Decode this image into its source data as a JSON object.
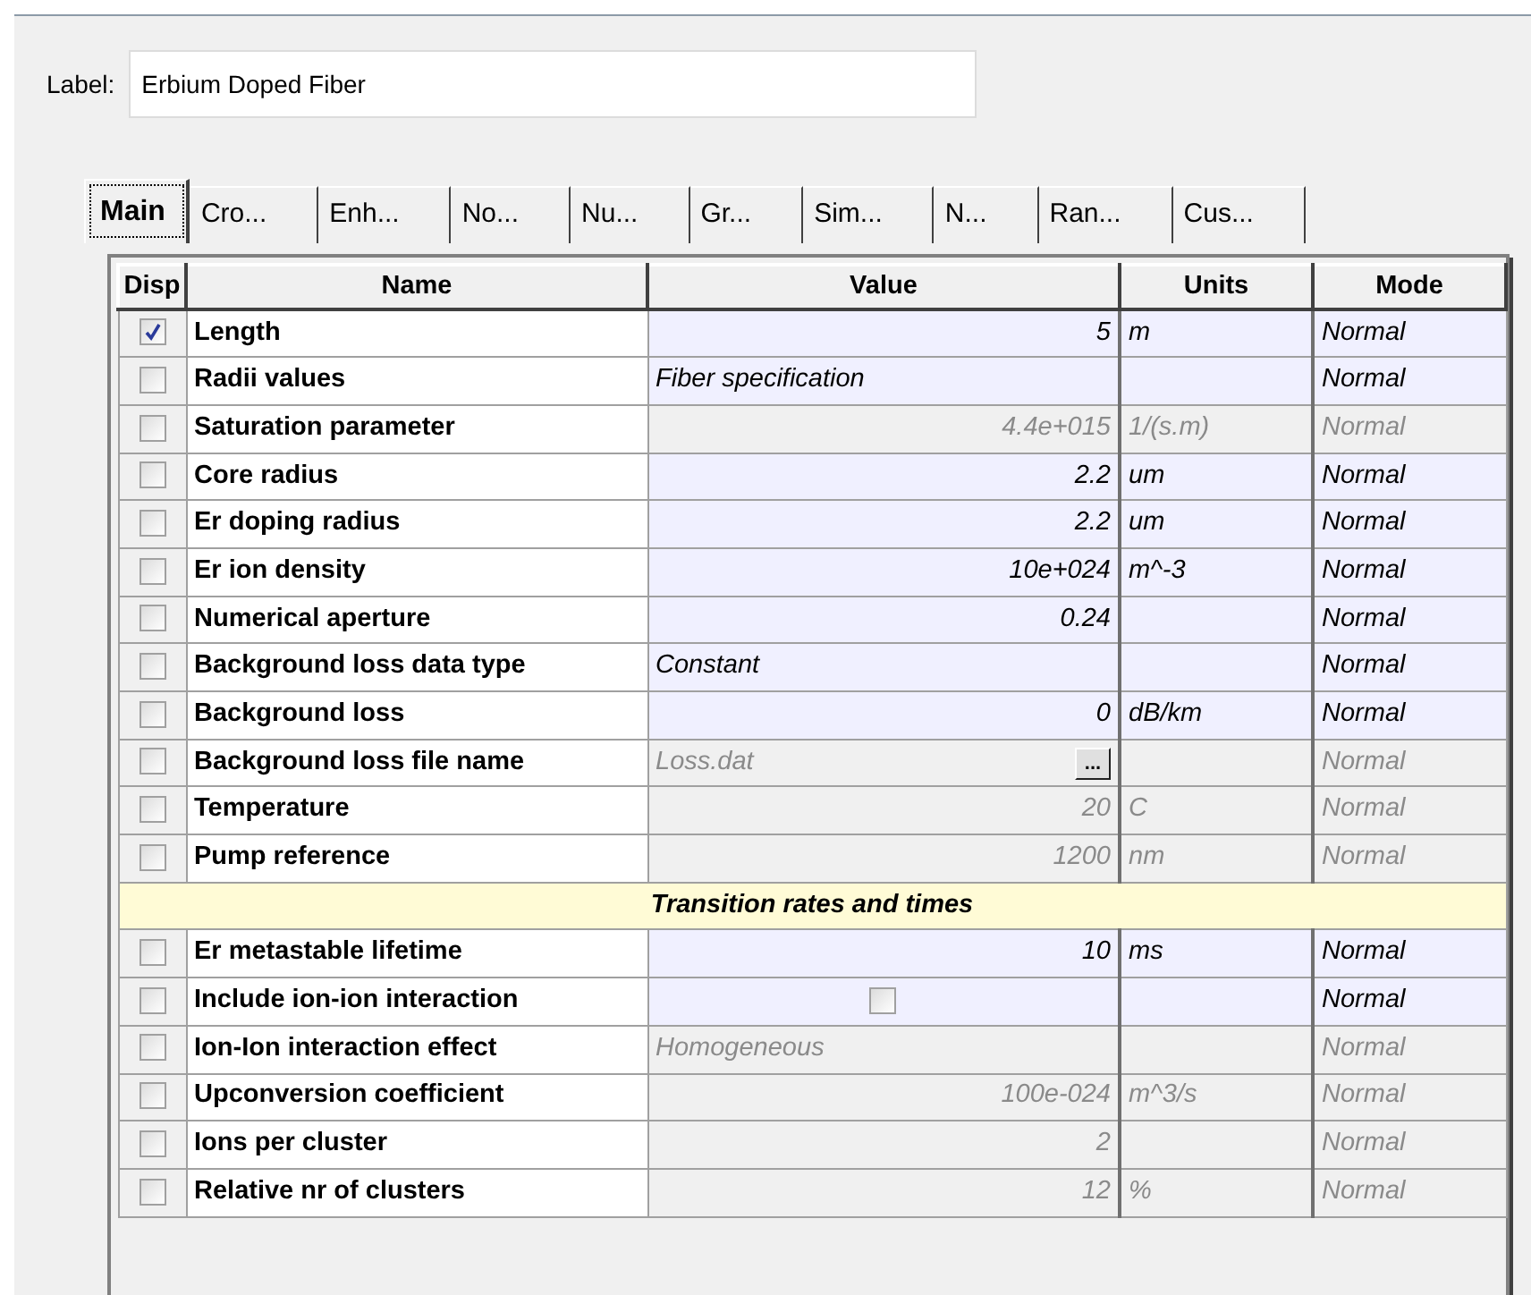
{
  "label_field": {
    "label": "Label:",
    "value": "Erbium Doped Fiber"
  },
  "tabs": [
    {
      "label": "Main",
      "selected": true
    },
    {
      "label": "Cro...",
      "selected": false
    },
    {
      "label": "Enh...",
      "selected": false
    },
    {
      "label": "No...",
      "selected": false
    },
    {
      "label": "Nu...",
      "selected": false
    },
    {
      "label": "Gr...",
      "selected": false
    },
    {
      "label": "Sim...",
      "selected": false
    },
    {
      "label": "N...",
      "selected": false
    },
    {
      "label": "Ran...",
      "selected": false
    },
    {
      "label": "Cus...",
      "selected": false
    }
  ],
  "table": {
    "columns": [
      "Disp",
      "Name",
      "Value",
      "Units",
      "Mode"
    ],
    "rows": [
      {
        "kind": "number",
        "checked": true,
        "name": "Length",
        "value": "5",
        "units": "m",
        "mode": "Normal",
        "disabled": false
      },
      {
        "kind": "text",
        "checked": false,
        "name": "Radii values",
        "value": "Fiber specification",
        "mode": "Normal",
        "disabled": false
      },
      {
        "kind": "number",
        "checked": false,
        "name": "Saturation parameter",
        "value": "4.4e+015",
        "units": "1/(s.m)",
        "mode": "Normal",
        "disabled": true
      },
      {
        "kind": "number",
        "checked": false,
        "name": "Core radius",
        "value": "2.2",
        "units": "um",
        "mode": "Normal",
        "disabled": false
      },
      {
        "kind": "number",
        "checked": false,
        "name": "Er doping radius",
        "value": "2.2",
        "units": "um",
        "mode": "Normal",
        "disabled": false
      },
      {
        "kind": "number",
        "checked": false,
        "name": "Er ion density",
        "value": "10e+024",
        "units": "m^-3",
        "mode": "Normal",
        "disabled": false
      },
      {
        "kind": "number",
        "checked": false,
        "name": "Numerical aperture",
        "value": "0.24",
        "mode": "Normal",
        "disabled": false
      },
      {
        "kind": "text",
        "checked": false,
        "name": "Background loss data type",
        "value": "Constant",
        "mode": "Normal",
        "disabled": false
      },
      {
        "kind": "number",
        "checked": false,
        "name": "Background loss",
        "value": "0",
        "units": "dB/km",
        "mode": "Normal",
        "disabled": false
      },
      {
        "kind": "file",
        "checked": false,
        "name": "Background loss file name",
        "value": "Loss.dat",
        "button": "...",
        "mode": "Normal",
        "disabled": true
      },
      {
        "kind": "number",
        "checked": false,
        "name": "Temperature",
        "value": "20",
        "units": "C",
        "mode": "Normal",
        "disabled": true
      },
      {
        "kind": "number",
        "checked": false,
        "name": "Pump reference",
        "value": "1200",
        "units": "nm",
        "mode": "Normal",
        "disabled": true
      },
      {
        "kind": "section",
        "title": "Transition rates and times"
      },
      {
        "kind": "number",
        "checked": false,
        "name": "Er metastable lifetime",
        "value": "10",
        "units": "ms",
        "mode": "Normal",
        "disabled": false
      },
      {
        "kind": "checkbox",
        "checked": false,
        "name": "Include ion-ion interaction",
        "value_checked": false,
        "mode": "Normal",
        "disabled": false
      },
      {
        "kind": "text",
        "checked": false,
        "name": "Ion-Ion interaction effect",
        "value": "Homogeneous",
        "mode": "Normal",
        "disabled": true
      },
      {
        "kind": "number",
        "checked": false,
        "name": "Upconversion coefficient",
        "value": "100e-024",
        "units": "m^3/s",
        "mode": "Normal",
        "disabled": true
      },
      {
        "kind": "number",
        "checked": false,
        "name": "Ions per cluster",
        "value": "2",
        "mode": "Normal",
        "disabled": true
      },
      {
        "kind": "number",
        "checked": false,
        "name": "Relative nr of clusters",
        "value": "12",
        "units": "%",
        "mode": "Normal",
        "disabled": true
      }
    ]
  }
}
